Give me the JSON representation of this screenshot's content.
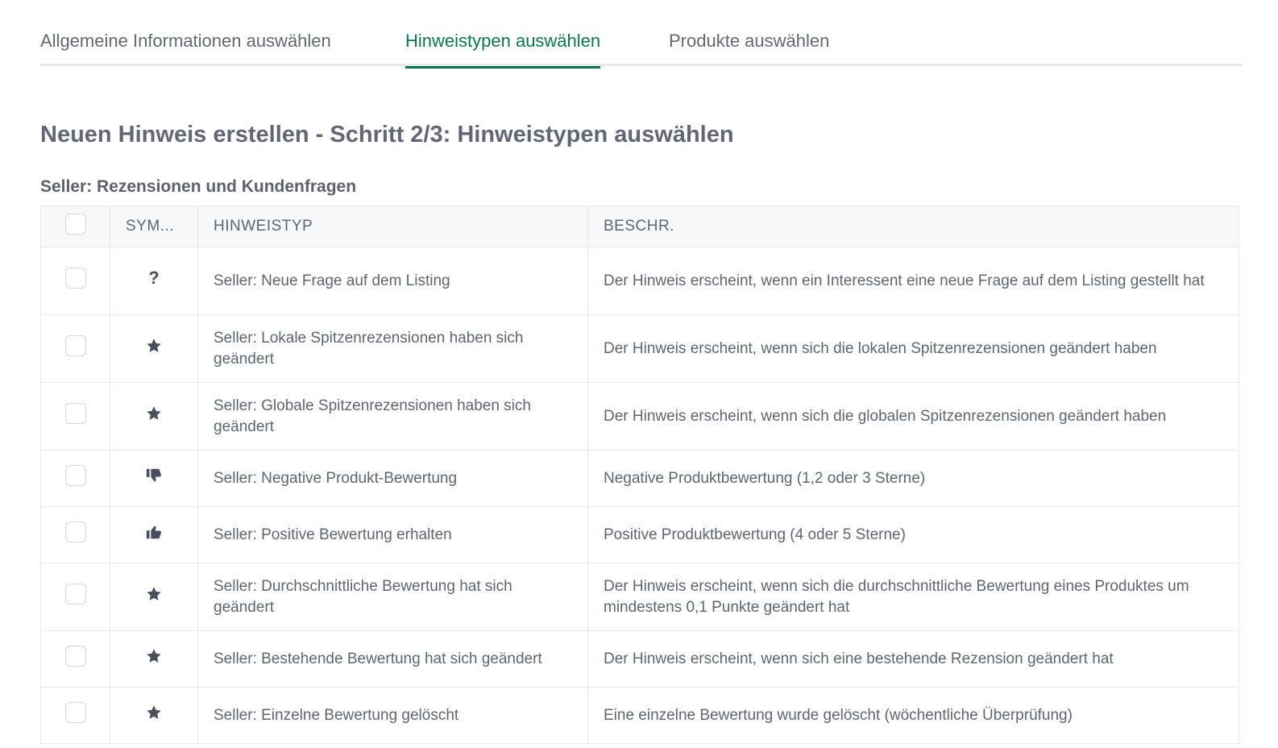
{
  "tabs": [
    {
      "label": "Allgemeine Informationen auswählen",
      "active": false
    },
    {
      "label": "Hinweistypen auswählen",
      "active": true
    },
    {
      "label": "Produkte auswählen",
      "active": false
    }
  ],
  "page_title": "Neuen Hinweis erstellen - Schritt 2/3: Hinweistypen auswählen",
  "section_title": "Seller: Rezensionen und Kundenfragen",
  "table": {
    "headers": {
      "symbol": "SYM...",
      "type": "HINWEISTYP",
      "description": "BESCHR."
    },
    "rows": [
      {
        "icon": "question-icon",
        "symbol_text": "?",
        "type": "Seller: Neue Frage auf dem Listing",
        "description": "Der Hinweis erscheint, wenn ein Interessent eine neue Frage auf dem Listing gestellt hat",
        "checked": false
      },
      {
        "icon": "star-icon",
        "type": "Seller: Lokale Spitzenrezensionen haben sich geändert",
        "description": "Der Hinweis erscheint, wenn sich die lokalen Spitzenrezensionen geändert haben",
        "checked": false
      },
      {
        "icon": "star-icon",
        "type": "Seller: Globale Spitzenrezensionen haben sich geändert",
        "description": "Der Hinweis erscheint, wenn sich die globalen Spitzenrezensionen geändert haben",
        "checked": false
      },
      {
        "icon": "thumbs-down-icon",
        "type": "Seller: Negative Produkt-Bewertung",
        "description": "Negative Produktbewertung (1,2 oder 3 Sterne)",
        "checked": false
      },
      {
        "icon": "thumbs-up-icon",
        "type": "Seller: Positive Bewertung erhalten",
        "description": "Positive Produktbewertung (4 oder 5 Sterne)",
        "checked": false
      },
      {
        "icon": "star-icon",
        "type": "Seller: Durchschnittliche Bewertung hat sich geändert",
        "description": "Der Hinweis erscheint, wenn sich die durchschnittliche Bewertung eines Produktes um mindestens 0,1 Punkte geändert hat",
        "checked": false
      },
      {
        "icon": "star-icon",
        "type": "Seller: Bestehende Bewertung hat sich geändert",
        "description": "Der Hinweis erscheint, wenn sich eine bestehende Rezension geändert hat",
        "checked": false
      },
      {
        "icon": "star-icon",
        "type": "Seller: Einzelne Bewertung gelöscht",
        "description": "Eine einzelne Bewertung wurde gelöscht (wöchentliche Überprüfung)",
        "checked": false
      }
    ]
  },
  "colors": {
    "accent": "#077a4d",
    "text": "#5f6475",
    "icon": "#4a4f5e",
    "border": "#e6e8ec",
    "header_bg": "#f7f8fa"
  }
}
